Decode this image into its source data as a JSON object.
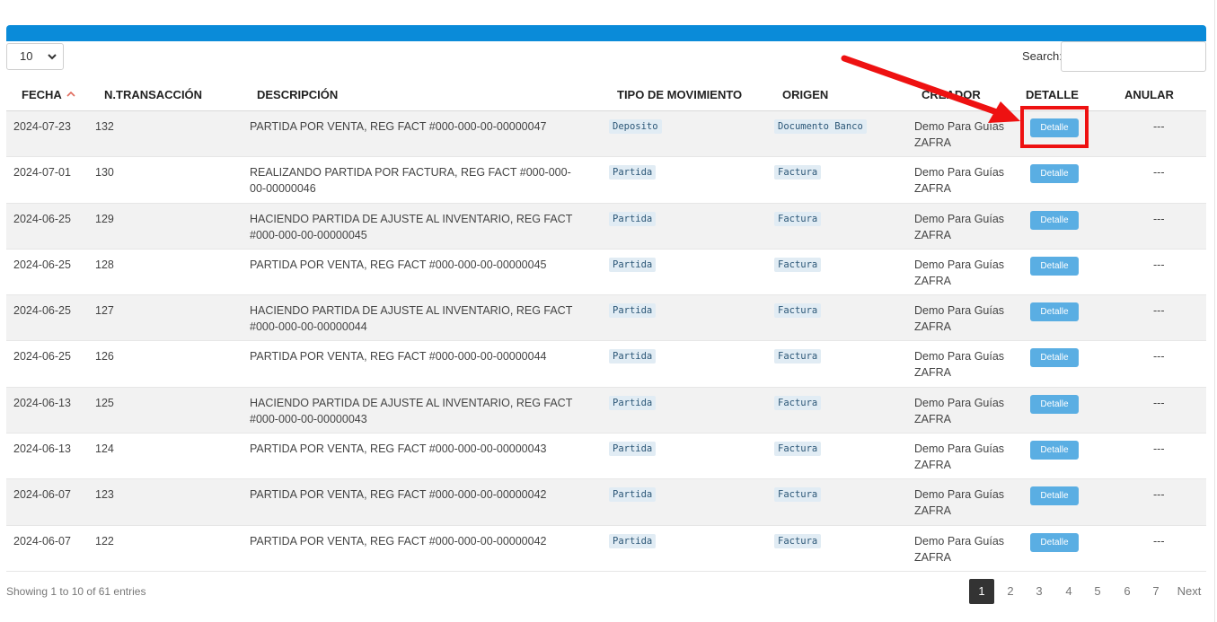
{
  "length_menu": {
    "selected": "10"
  },
  "search": {
    "label": "Search:",
    "value": ""
  },
  "columns": [
    "FECHA",
    "N.TRANSACCIÓN",
    "DESCRIPCIÓN",
    "TIPO DE MOVIMIENTO",
    "ORIGEN",
    "CREADOR",
    "DETALLE",
    "ANULAR"
  ],
  "rows": [
    {
      "fecha": "2024-07-23",
      "num": "132",
      "desc": "PARTIDA POR VENTA, REG FACT #000-000-00-00000047",
      "tipo": "Deposito",
      "origen": "Documento Banco",
      "creador": "Demo Para Guías ZAFRA",
      "detalle": "Detalle",
      "anular": "---"
    },
    {
      "fecha": "2024-07-01",
      "num": "130",
      "desc": "REALIZANDO PARTIDA POR FACTURA, REG FACT #000-000-00-00000046",
      "tipo": "Partida",
      "origen": "Factura",
      "creador": "Demo Para Guías ZAFRA",
      "detalle": "Detalle",
      "anular": "---"
    },
    {
      "fecha": "2024-06-25",
      "num": "129",
      "desc": "HACIENDO PARTIDA DE AJUSTE AL INVENTARIO, REG FACT #000-000-00-00000045",
      "tipo": "Partida",
      "origen": "Factura",
      "creador": "Demo Para Guías ZAFRA",
      "detalle": "Detalle",
      "anular": "---"
    },
    {
      "fecha": "2024-06-25",
      "num": "128",
      "desc": "PARTIDA POR VENTA, REG FACT #000-000-00-00000045",
      "tipo": "Partida",
      "origen": "Factura",
      "creador": "Demo Para Guías ZAFRA",
      "detalle": "Detalle",
      "anular": "---"
    },
    {
      "fecha": "2024-06-25",
      "num": "127",
      "desc": "HACIENDO PARTIDA DE AJUSTE AL INVENTARIO, REG FACT #000-000-00-00000044",
      "tipo": "Partida",
      "origen": "Factura",
      "creador": "Demo Para Guías ZAFRA",
      "detalle": "Detalle",
      "anular": "---"
    },
    {
      "fecha": "2024-06-25",
      "num": "126",
      "desc": "PARTIDA POR VENTA, REG FACT #000-000-00-00000044",
      "tipo": "Partida",
      "origen": "Factura",
      "creador": "Demo Para Guías ZAFRA",
      "detalle": "Detalle",
      "anular": "---"
    },
    {
      "fecha": "2024-06-13",
      "num": "125",
      "desc": "HACIENDO PARTIDA DE AJUSTE AL INVENTARIO, REG FACT #000-000-00-00000043",
      "tipo": "Partida",
      "origen": "Factura",
      "creador": "Demo Para Guías ZAFRA",
      "detalle": "Detalle",
      "anular": "---"
    },
    {
      "fecha": "2024-06-13",
      "num": "124",
      "desc": "PARTIDA POR VENTA, REG FACT #000-000-00-00000043",
      "tipo": "Partida",
      "origen": "Factura",
      "creador": "Demo Para Guías ZAFRA",
      "detalle": "Detalle",
      "anular": "---"
    },
    {
      "fecha": "2024-06-07",
      "num": "123",
      "desc": "PARTIDA POR VENTA, REG FACT #000-000-00-00000042",
      "tipo": "Partida",
      "origen": "Factura",
      "creador": "Demo Para Guías ZAFRA",
      "detalle": "Detalle",
      "anular": "---"
    },
    {
      "fecha": "2024-06-07",
      "num": "122",
      "desc": "PARTIDA POR VENTA, REG FACT #000-000-00-00000042",
      "tipo": "Partida",
      "origen": "Factura",
      "creador": "Demo Para Guías ZAFRA",
      "detalle": "Detalle",
      "anular": "---"
    }
  ],
  "footer": {
    "info": "Showing 1 to 10 of 61 entries"
  },
  "pagination": {
    "pages": [
      "1",
      "2",
      "3",
      "4",
      "5",
      "6",
      "7"
    ],
    "active": "1",
    "next": "Next"
  },
  "colors": {
    "header_bar": "#0a8bd9",
    "button": "#5aaee3",
    "highlight": "#ee1111",
    "badge_bg": "#e1ecf4"
  }
}
